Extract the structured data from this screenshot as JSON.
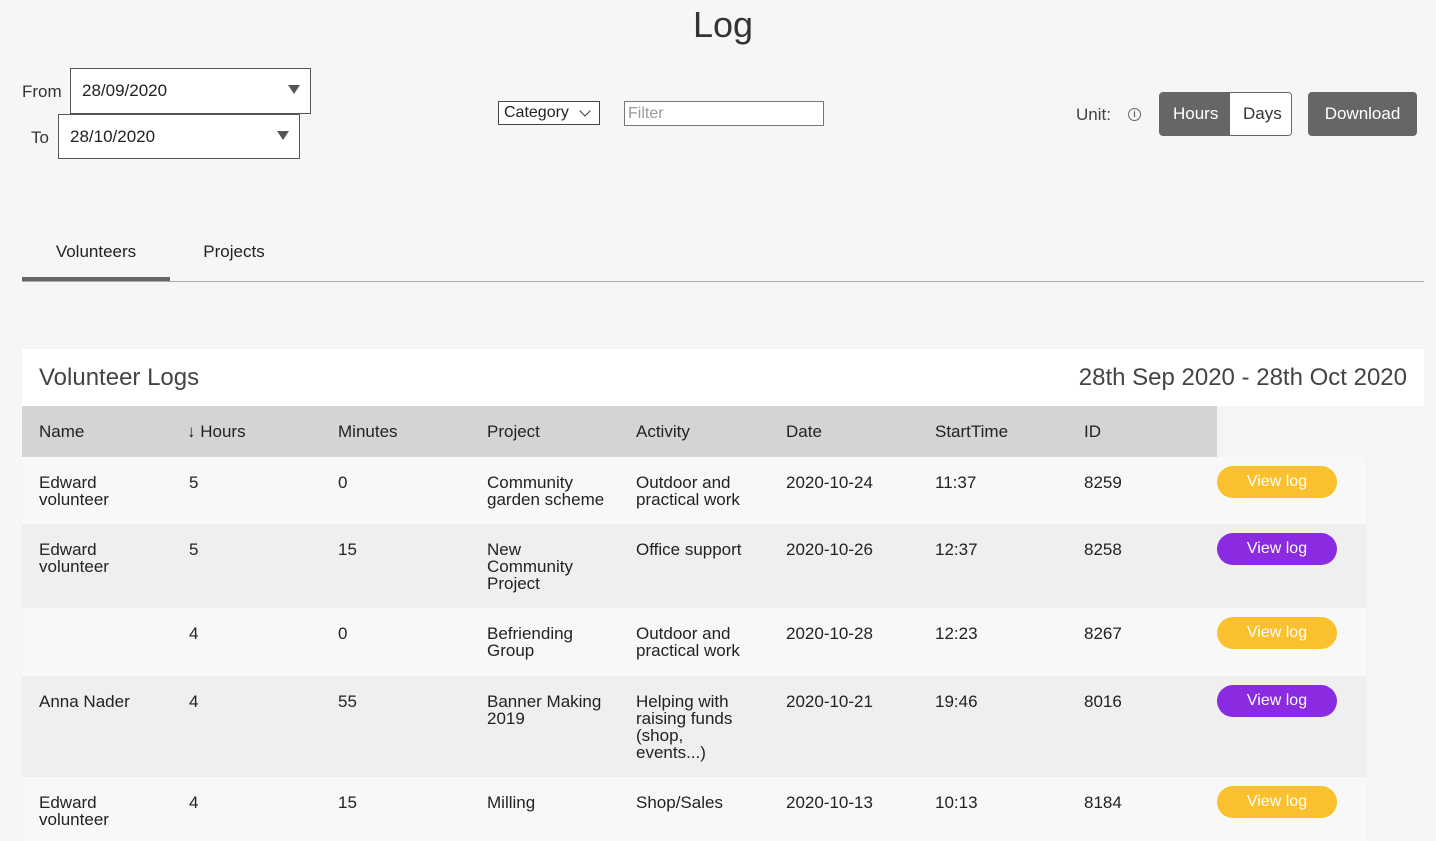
{
  "header": {
    "title": "Log"
  },
  "filters": {
    "from_label": "From",
    "from_value": "28/09/2020",
    "to_label": "To",
    "to_value": "28/10/2020",
    "category_label": "Category",
    "filter_placeholder": "Filter",
    "unit_label": "Unit:",
    "info_icon": "info-icon",
    "unit_options": [
      "Hours",
      "Days"
    ],
    "unit_selected": "Hours",
    "download_label": "Download"
  },
  "tabs": [
    {
      "label": "Volunteers",
      "active": true
    },
    {
      "label": "Projects",
      "active": false
    }
  ],
  "panel": {
    "title": "Volunteer Logs",
    "date_range": "28th Sep 2020 - 28th Oct 2020"
  },
  "table": {
    "columns": [
      "Name",
      "↓ Hours",
      "Minutes",
      "Project",
      "Activity",
      "Date",
      "StartTime",
      "ID"
    ],
    "rows": [
      {
        "name": "Edward volunteer",
        "hours": "5",
        "minutes": "0",
        "project": "Community garden scheme",
        "activity": "Outdoor and practical work",
        "date": "2020-10-24",
        "start": "11:37",
        "id": "8259",
        "action": "View log",
        "action_color": "#fbc02d"
      },
      {
        "name": "Edward volunteer",
        "hours": "5",
        "minutes": "15",
        "project": "New Community Project",
        "activity": "Office support",
        "date": "2020-10-26",
        "start": "12:37",
        "id": "8258",
        "action": "View log",
        "action_color": "#8a2be2"
      },
      {
        "name": "",
        "hours": "4",
        "minutes": "0",
        "project": "Befriending Group",
        "activity": "Outdoor and practical work",
        "date": "2020-10-28",
        "start": "12:23",
        "id": "8267",
        "action": "View log",
        "action_color": "#fbc02d"
      },
      {
        "name": "Anna Nader",
        "hours": "4",
        "minutes": "55",
        "project": "Banner Making 2019",
        "activity": "Helping with raising funds (shop, events...)",
        "date": "2020-10-21",
        "start": "19:46",
        "id": "8016",
        "action": "View log",
        "action_color": "#8a2be2"
      },
      {
        "name": "Edward volunteer",
        "hours": "4",
        "minutes": "15",
        "project": "Milling",
        "activity": "Shop/Sales",
        "date": "2020-10-13",
        "start": "10:13",
        "id": "8184",
        "action": "View log",
        "action_color": "#fbc02d"
      }
    ]
  }
}
